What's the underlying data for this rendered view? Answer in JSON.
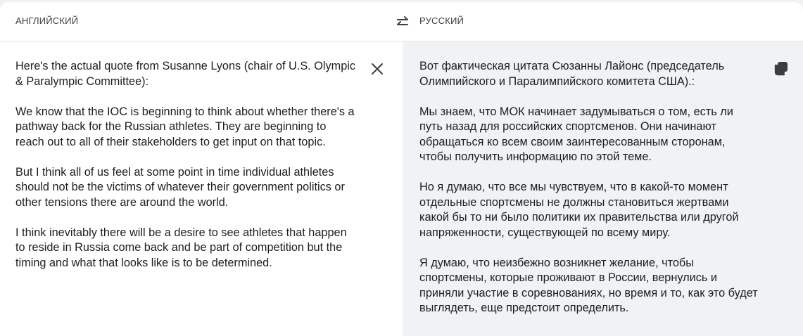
{
  "languages": {
    "source": "АНГЛИЙСКИЙ",
    "target": "РУССКИЙ"
  },
  "icons": {
    "swap": "swap-languages-icon",
    "clear": "close-icon",
    "copy": "copy-icon"
  },
  "colors": {
    "text": "#1b1d21",
    "icon": "#3a3d42",
    "target_background": "#f1f2f4"
  },
  "source_text": "Here's the actual quote from Susanne Lyons (chair of U.S. Olympic & Paralympic Committee):\n\nWe know that the IOC is beginning to think about whether there's a pathway back for the Russian athletes. They are beginning to reach out to all of their stakeholders to get input on that topic.\n\nBut I think all of us feel at some point in time individual athletes should not be the victims of whatever their government politics or other tensions there are around the world.\n\nI think inevitably there will be a desire to see athletes that happen to reside in Russia come back and be part of competition but the timing and what that looks like is to be determined.",
  "translated_text": "Вот фактическая цитата Сюзанны Лайонс (председатель Олимпийского и Паралимпийского комитета США).:\n\nМы знаем, что МОК начинает задумываться о том, есть ли путь назад для российских спортсменов. Они начинают обращаться ко всем своим заинтересованным сторонам, чтобы получить информацию по этой теме.\n\nНо я думаю, что все мы чувствуем, что в какой-то момент отдельные спортсмены не должны становиться жертвами какой бы то ни было политики их правительства или другой напряженности, существующей по всему миру.\n\nЯ думаю, что неизбежно возникнет желание, чтобы спортсмены, которые проживают в России, вернулись и приняли участие в соревнованиях, но время и то, как это будет выглядеть, еще предстоит определить."
}
